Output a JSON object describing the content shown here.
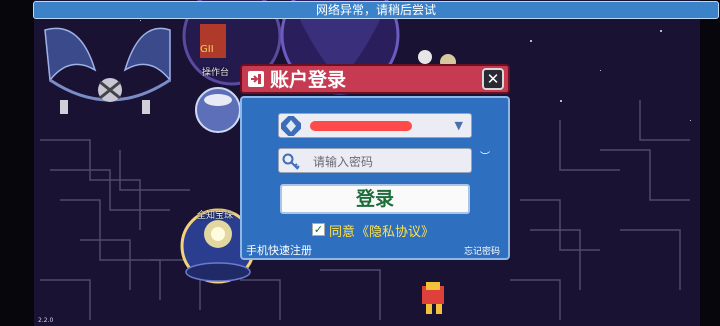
{
  "network_banner": "网络异常，请稍后尝试",
  "npc_labels": {
    "operation": "操作台",
    "treasure": "全知宝珠"
  },
  "version": "2.2.0",
  "login_dialog": {
    "title": "账户登录",
    "password_placeholder": "请输入密码",
    "login_button": "登录",
    "agree_label": "同意",
    "privacy_link": "《隐私协议》",
    "register_link": "手机快速注册",
    "forgot_link": "忘记密码",
    "agree_checked": true
  },
  "colors": {
    "header": "#c63a52",
    "panel": "#2f6fbf",
    "banner": "#3b82c9",
    "accent_text": "#ffe14a",
    "button_text": "#1c6d3a"
  }
}
